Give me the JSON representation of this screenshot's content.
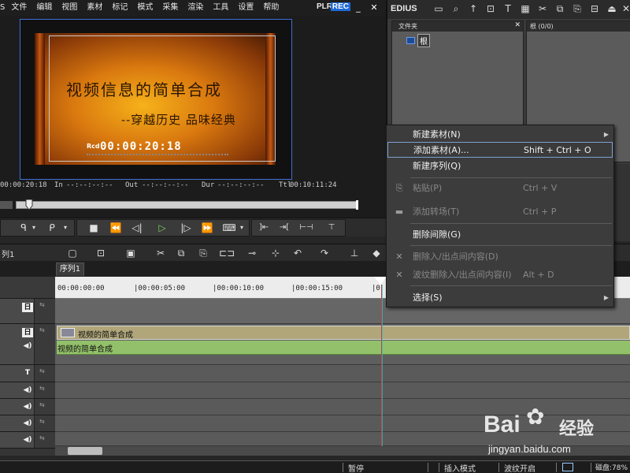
{
  "menubar": {
    "logo": "S",
    "items": [
      "文件",
      "编辑",
      "视图",
      "素材",
      "标记",
      "模式",
      "采集",
      "渲染",
      "工具",
      "设置",
      "帮助"
    ],
    "plr": "PLR",
    "rec": "REC",
    "minimize": "_",
    "close": "✕"
  },
  "monitor": {
    "title_line1": "视频信息的简单合成",
    "title_line2": "--穿越历史 品味经典",
    "rcd_label": "Rcd",
    "rcd_timecode": "00:00:20:18"
  },
  "timecodes": {
    "current": "00:00:20:18",
    "in_label": "In",
    "in_value": "--:--:--:--",
    "out_label": "Out",
    "out_value": "--:--:--:--",
    "dur_label": "Dur",
    "dur_value": "--:--:--:--",
    "ttl_label": "Ttl",
    "ttl_value": "00:10:11:24"
  },
  "bin": {
    "title": "EDIUS",
    "folder_header": "文件夹",
    "folder_root": "根",
    "clip_header": "根 (0/0)"
  },
  "context_menu": {
    "items": [
      {
        "label": "新建素材(N)",
        "shortcut": "",
        "disabled": false,
        "submenu": true,
        "highlight": false
      },
      {
        "label": "添加素材(A)...",
        "shortcut": "Shift + Ctrl + O",
        "disabled": false,
        "submenu": false,
        "highlight": true
      },
      {
        "label": "新建序列(Q)",
        "shortcut": "",
        "disabled": false,
        "submenu": false,
        "highlight": false
      },
      {
        "label": "粘贴(P)",
        "shortcut": "Ctrl + V",
        "disabled": true,
        "submenu": false,
        "highlight": false
      },
      {
        "label": "添加转场(T)",
        "shortcut": "Ctrl + P",
        "disabled": true,
        "submenu": false,
        "highlight": false
      },
      {
        "label": "删除间隙(G)",
        "shortcut": "",
        "disabled": false,
        "submenu": false,
        "highlight": false
      },
      {
        "label": "删除入/出点间内容(D)",
        "shortcut": "",
        "disabled": true,
        "submenu": false,
        "highlight": false
      },
      {
        "label": "波纹删除入/出点间内容(I)",
        "shortcut": "Alt + D",
        "disabled": true,
        "submenu": false,
        "highlight": false
      },
      {
        "label": "选择(S)",
        "shortcut": "",
        "disabled": false,
        "submenu": true,
        "highlight": false
      }
    ]
  },
  "timeline": {
    "sequence_name": "列1",
    "tab": "序列1",
    "ruler": [
      "00:00:00:00",
      "|00:00:05:00",
      "|00:00:10:00",
      "|00:00:15:00",
      "|0"
    ],
    "video_clip_name": "视频的简单合成",
    "audio_clip_name": "视频的简单合成",
    "track_t_label": "T",
    "track_vision_label": "日"
  },
  "statusbar": {
    "pause": "暂停",
    "insert_mode": "插入模式",
    "ripple_on": "波纹开启",
    "disk": "磁盘:78%"
  },
  "watermark": {
    "brand_bai": "Bai",
    "brand_jy": "经验",
    "url": "jingyan.baidu.com"
  }
}
